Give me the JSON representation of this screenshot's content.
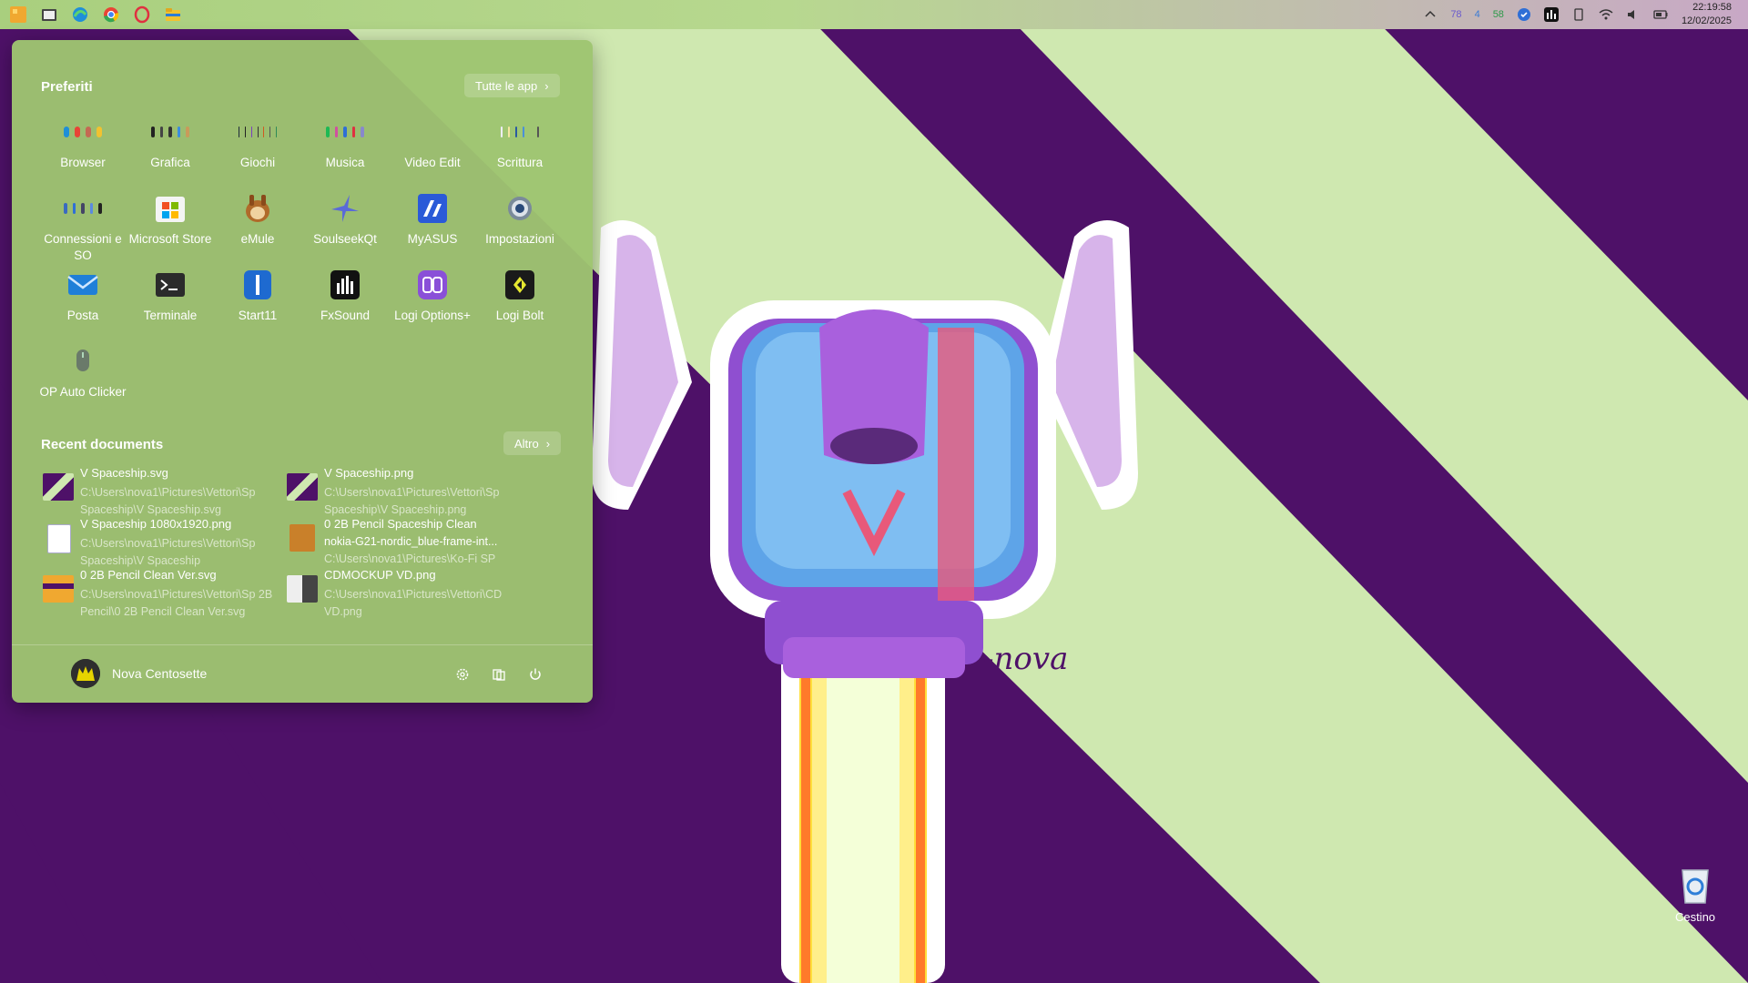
{
  "taskbar": {
    "apps": [
      "start11-icon",
      "task-view-icon",
      "edge-icon",
      "chrome-icon",
      "opera-icon",
      "file-explorer-icon"
    ],
    "tray": {
      "badge_a": "78",
      "badge_b": "4",
      "badge_c": "58",
      "time": "22:19:58",
      "date": "12/02/2025"
    }
  },
  "start_menu": {
    "favorites_title": "Preferiti",
    "all_apps_label": "Tutte le app",
    "tiles": [
      {
        "label": "Browser"
      },
      {
        "label": "Grafica"
      },
      {
        "label": "Giochi"
      },
      {
        "label": "Musica"
      },
      {
        "label": "Video Edit"
      },
      {
        "label": "Scrittura"
      },
      {
        "label": "Connessioni e SO"
      },
      {
        "label": "Microsoft Store"
      },
      {
        "label": "eMule"
      },
      {
        "label": "SoulseekQt"
      },
      {
        "label": "MyASUS"
      },
      {
        "label": "Impostazioni"
      },
      {
        "label": "Posta"
      },
      {
        "label": "Terminale"
      },
      {
        "label": "Start11"
      },
      {
        "label": "FxSound"
      },
      {
        "label": "Logi Options+"
      },
      {
        "label": "Logi Bolt"
      },
      {
        "label": "OP Auto Clicker"
      }
    ],
    "recent_title": "Recent documents",
    "more_label": "Altro",
    "documents": [
      {
        "name": "V Spaceship.svg",
        "path": "C:\\Users\\nova1\\Pictures\\Vettori\\Sp Spaceship\\V Spaceship.svg"
      },
      {
        "name": "V Spaceship.png",
        "path": "C:\\Users\\nova1\\Pictures\\Vettori\\Sp Spaceship\\V Spaceship.png"
      },
      {
        "name": "V Spaceship 1080x1920.png",
        "path": "C:\\Users\\nova1\\Pictures\\Vettori\\Sp Spaceship\\V Spaceship"
      },
      {
        "name": "0 2B Pencil Spaceship Clean",
        "subname": "nokia-G21-nordic_blue-frame-int...",
        "path": "C:\\Users\\nova1\\Pictures\\Ko-Fi SP"
      },
      {
        "name": "0 2B Pencil Clean Ver.svg",
        "path": "C:\\Users\\nova1\\Pictures\\Vettori\\Sp 2B Pencil\\0 2B Pencil Clean Ver.svg"
      },
      {
        "name": "CDMOCKUP VD.png",
        "path": "C:\\Users\\nova1\\Pictures\\Vettori\\CD VD.png"
      }
    ],
    "user_name": "Nova Centosette"
  },
  "desktop": {
    "recycle_bin_label": "Cestino"
  },
  "colors": {
    "purple": "#4e1168",
    "green": "#cfe8b0",
    "menu": "#9ec570"
  }
}
